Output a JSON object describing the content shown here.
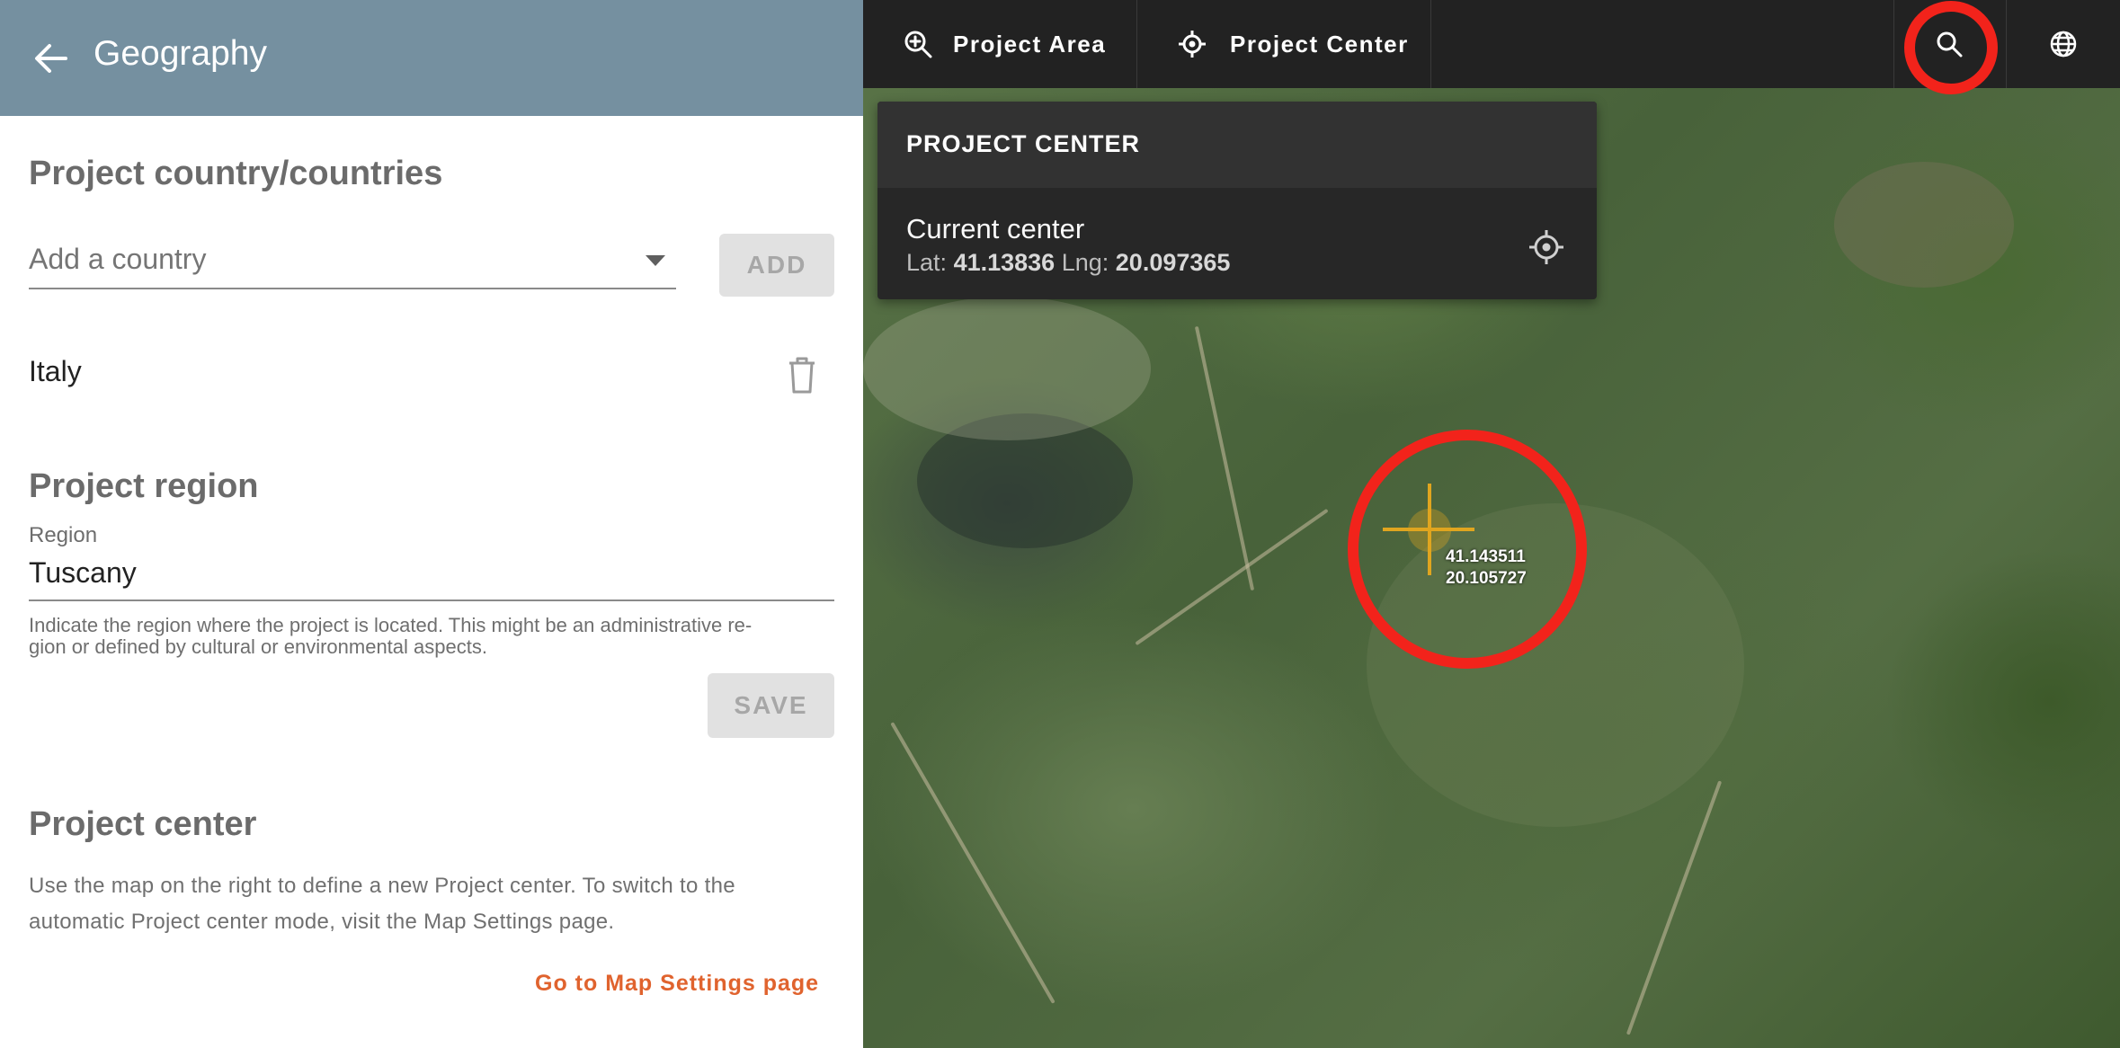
{
  "appbar": {
    "title": "Geography"
  },
  "countries": {
    "heading": "Project country/countries",
    "select_placeholder": "Add a country",
    "add_label": "ADD",
    "items": [
      "Italy"
    ]
  },
  "region": {
    "heading": "Project region",
    "field_label": "Region",
    "field_value": "Tuscany",
    "helper_line1": "Indicate the region where the project is located. This might be an administrative re-",
    "helper_line2": "gion or defined by cultural or environmental aspects.",
    "save_label": "SAVE"
  },
  "center": {
    "heading": "Project center",
    "description_line1": "Use the map on the right to define a new Project center. To switch to the",
    "description_line2": "automatic Project center mode, visit the Map Settings page.",
    "link_label": "Go to Map Settings page"
  },
  "map_toolbar": {
    "project_area_label": "Project Area",
    "project_center_label": "Project Center",
    "icons": [
      "zoom-in-icon",
      "crosshair-icon",
      "search-icon",
      "globe-icon"
    ]
  },
  "popup": {
    "title": "PROJECT CENTER",
    "current_label": "Current center",
    "lat_prefix": "Lat:",
    "lat_value": "41.13836",
    "lng_prefix": "Lng:",
    "lng_value": "20.097365"
  },
  "crosshair": {
    "lat": "41.143511",
    "lng": "20.105727"
  },
  "colors": {
    "appbar": "#7590a0",
    "toolbar": "#222222",
    "link": "#e0632e",
    "highlight": "#f2231b",
    "crosshair": "#e0a51f"
  }
}
